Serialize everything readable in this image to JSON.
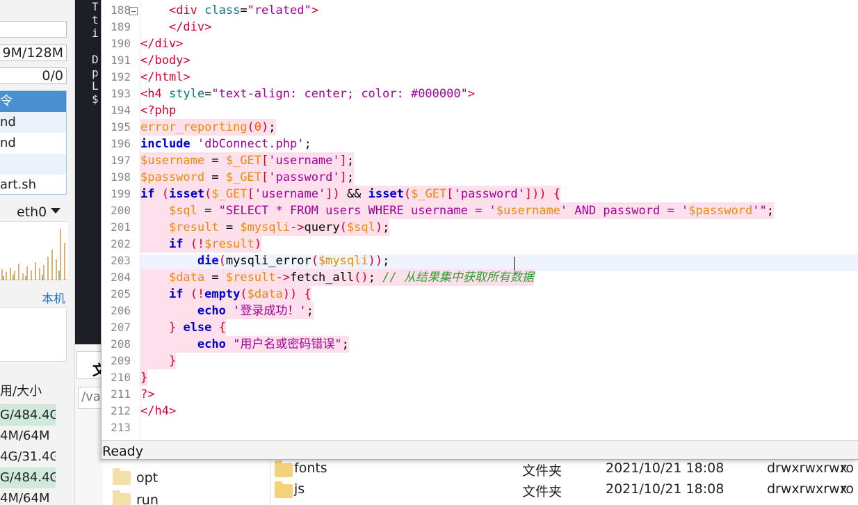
{
  "left_panel": {
    "memory_value": "9M/128M",
    "count_value": "0/0",
    "command_list": [
      "令",
      "nd",
      "nd",
      "",
      "art.sh"
    ],
    "interface": "eth0",
    "local_label": "本机",
    "disk_header": "用/大小",
    "disk_rows": [
      "G/484.4G",
      "4M/64M",
      "4G/31.4G",
      "G/484.4G",
      "4M/64M"
    ]
  },
  "terminal": {
    "lines": [
      "T",
      "t",
      "i",
      "",
      "D",
      "p",
      "L",
      "$"
    ],
    "tab_label": "文",
    "path_fragment": "/va"
  },
  "editor": {
    "line_numbers": [
      "188",
      "189",
      "190",
      "191",
      "192",
      "193",
      "194",
      "195",
      "196",
      "197",
      "198",
      "199",
      "200",
      "201",
      "202",
      "203",
      "204",
      "205",
      "206",
      "207",
      "208",
      "209",
      "210",
      "211",
      "212",
      "213"
    ],
    "status": "Ready"
  },
  "file_tree": {
    "items": [
      {
        "name": "opt"
      },
      {
        "name": "run"
      }
    ]
  },
  "file_list": {
    "rows": [
      {
        "name": "fonts",
        "type": "文件夹",
        "modified": "2021/10/21 18:08",
        "perm": "drwxrwxrwx",
        "owner": "ro"
      },
      {
        "name": "js",
        "type": "文件夹",
        "modified": "2021/10/21 18:08",
        "perm": "drwxrwxrwx",
        "owner": "ro"
      }
    ]
  },
  "colors": {
    "highlight": "#fde0ec",
    "current_line": "#eef3fd",
    "tag": "#d4002e",
    "string": "#a50099",
    "keyword": "#0000cc",
    "variable": "#f08a00",
    "comment": "#2f9e2f"
  }
}
